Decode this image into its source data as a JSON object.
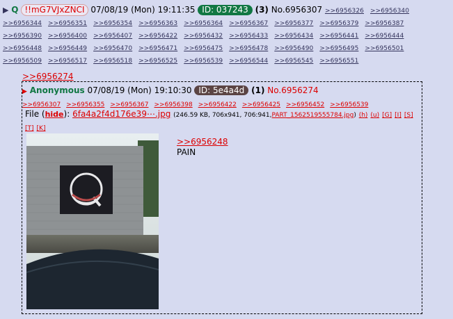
{
  "op": {
    "arrow": "▶",
    "name": "Q",
    "tripcode": "!!mG7VJxZNCI",
    "datetime": "07/08/19 (Mon) 19:11:35",
    "id_label": "ID: 037243",
    "post_count": "(3)",
    "post_no": "No.6956307",
    "backlinks": [
      ">>6956326",
      ">>6956340",
      ">>6956344",
      ">>6956351",
      ">>6956354",
      ">>6956363",
      ">>6956364",
      ">>6956367",
      ">>6956377",
      ">>6956379",
      ">>6956387",
      ">>6956390",
      ">>6956400",
      ">>6956407",
      ">>6956422",
      ">>6956432",
      ">>6956433",
      ">>6956434",
      ">>6956441",
      ">>6956444",
      ">>6956448",
      ">>6956449",
      ">>6956470",
      ">>6956471",
      ">>6956475",
      ">>6956478",
      ">>6956490",
      ">>6956495",
      ">>6956501",
      ">>6956509",
      ">>6956517",
      ">>6956518",
      ">>6956525",
      ">>6956539",
      ">>6956544",
      ">>6956545",
      ">>6956551"
    ]
  },
  "quote_link": ">>6956274",
  "reply": {
    "marker": "▶",
    "name": "Anonymous",
    "datetime": "07/08/19 (Mon) 19:10:30",
    "id_label": "ID: 5e4a4d",
    "post_count": "(1)",
    "post_no": "No.6956274",
    "backlinks": [
      ">>6956307",
      ">>6956355",
      ">>6956367",
      ">>6956398",
      ">>6956422",
      ">>6956425",
      ">>6956452",
      ">>6956539"
    ],
    "file_label": "File (",
    "hide_label": "hide",
    "file_after_hide": "):",
    "file_name": "6fa4a2f4d176e39⋯.jpg",
    "file_meta": "(246.59 KB, 706x941, 706:941,",
    "file_part": "PART_1562519555784.jpg",
    "file_close": ")",
    "file_actions": [
      "(h)",
      "(u)",
      "[G]",
      "[I]",
      "[S]",
      "[T]",
      "[K]"
    ],
    "message_link": ">>6956248",
    "message_text": "PAIN"
  }
}
